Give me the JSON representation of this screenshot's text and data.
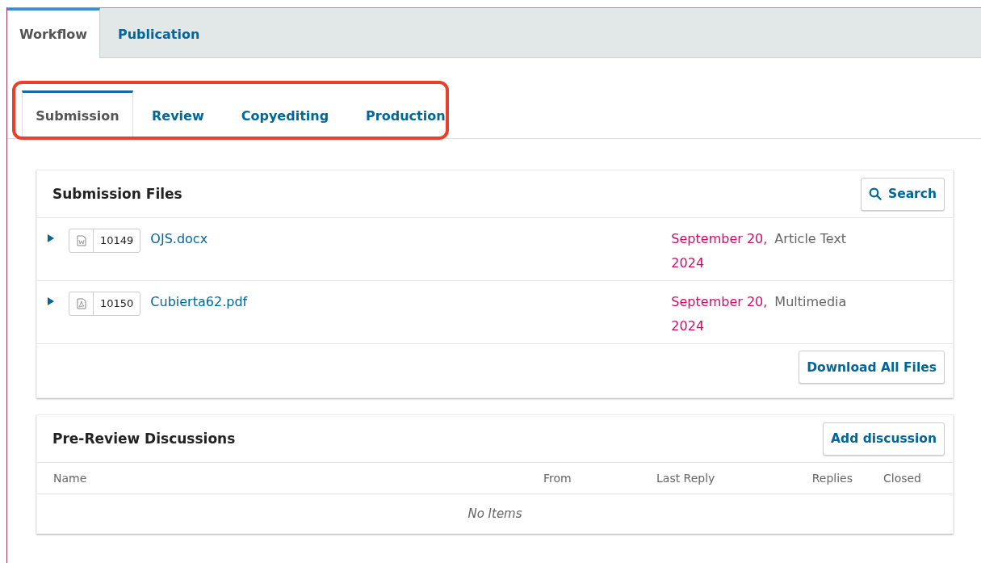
{
  "top_tabs": [
    {
      "label": "Workflow",
      "selected": true
    },
    {
      "label": "Publication",
      "selected": false
    }
  ],
  "stage_tabs": [
    {
      "label": "Submission",
      "selected": true
    },
    {
      "label": "Review",
      "selected": false
    },
    {
      "label": "Copyediting",
      "selected": false
    },
    {
      "label": "Production",
      "selected": false
    }
  ],
  "highlight": {
    "kind": "outline",
    "color": "#e8402a"
  },
  "submission_files": {
    "title": "Submission Files",
    "search_button": "Search",
    "rows": [
      {
        "kind": "word",
        "id": "10149",
        "name": "OJS.docx",
        "date": "September 20, 2024",
        "type": "Article Text"
      },
      {
        "kind": "pdf",
        "id": "10150",
        "name": "Cubierta62.pdf",
        "date": "September 20, 2024",
        "type": "Multimedia"
      }
    ],
    "download_button": "Download All Files"
  },
  "discussions": {
    "title": "Pre-Review Discussions",
    "add_button": "Add discussion",
    "columns": [
      "Name",
      "From",
      "Last Reply",
      "Replies",
      "Closed"
    ],
    "empty": "No Items"
  }
}
